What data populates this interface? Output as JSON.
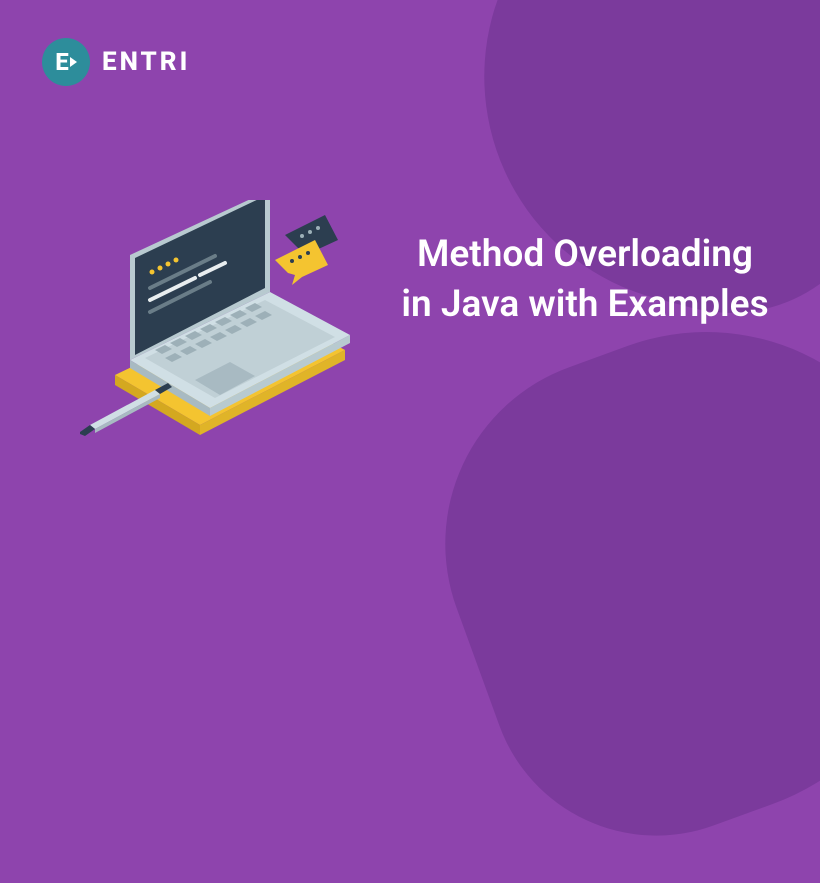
{
  "logo": {
    "brand_name": "ENTRI",
    "badge_letter": "E"
  },
  "title": "Method Overloading in Java with Examples",
  "colors": {
    "background": "#8e44ad",
    "background_shape": "#7b3a9c",
    "logo_badge": "#2d8d9b",
    "text": "#ffffff"
  },
  "illustration": {
    "description": "Isometric laptop on notebook with pen and chat bubbles",
    "laptop_screen_lines": 4,
    "has_pen": true,
    "has_notebook": true,
    "chat_bubble_count": 2
  }
}
